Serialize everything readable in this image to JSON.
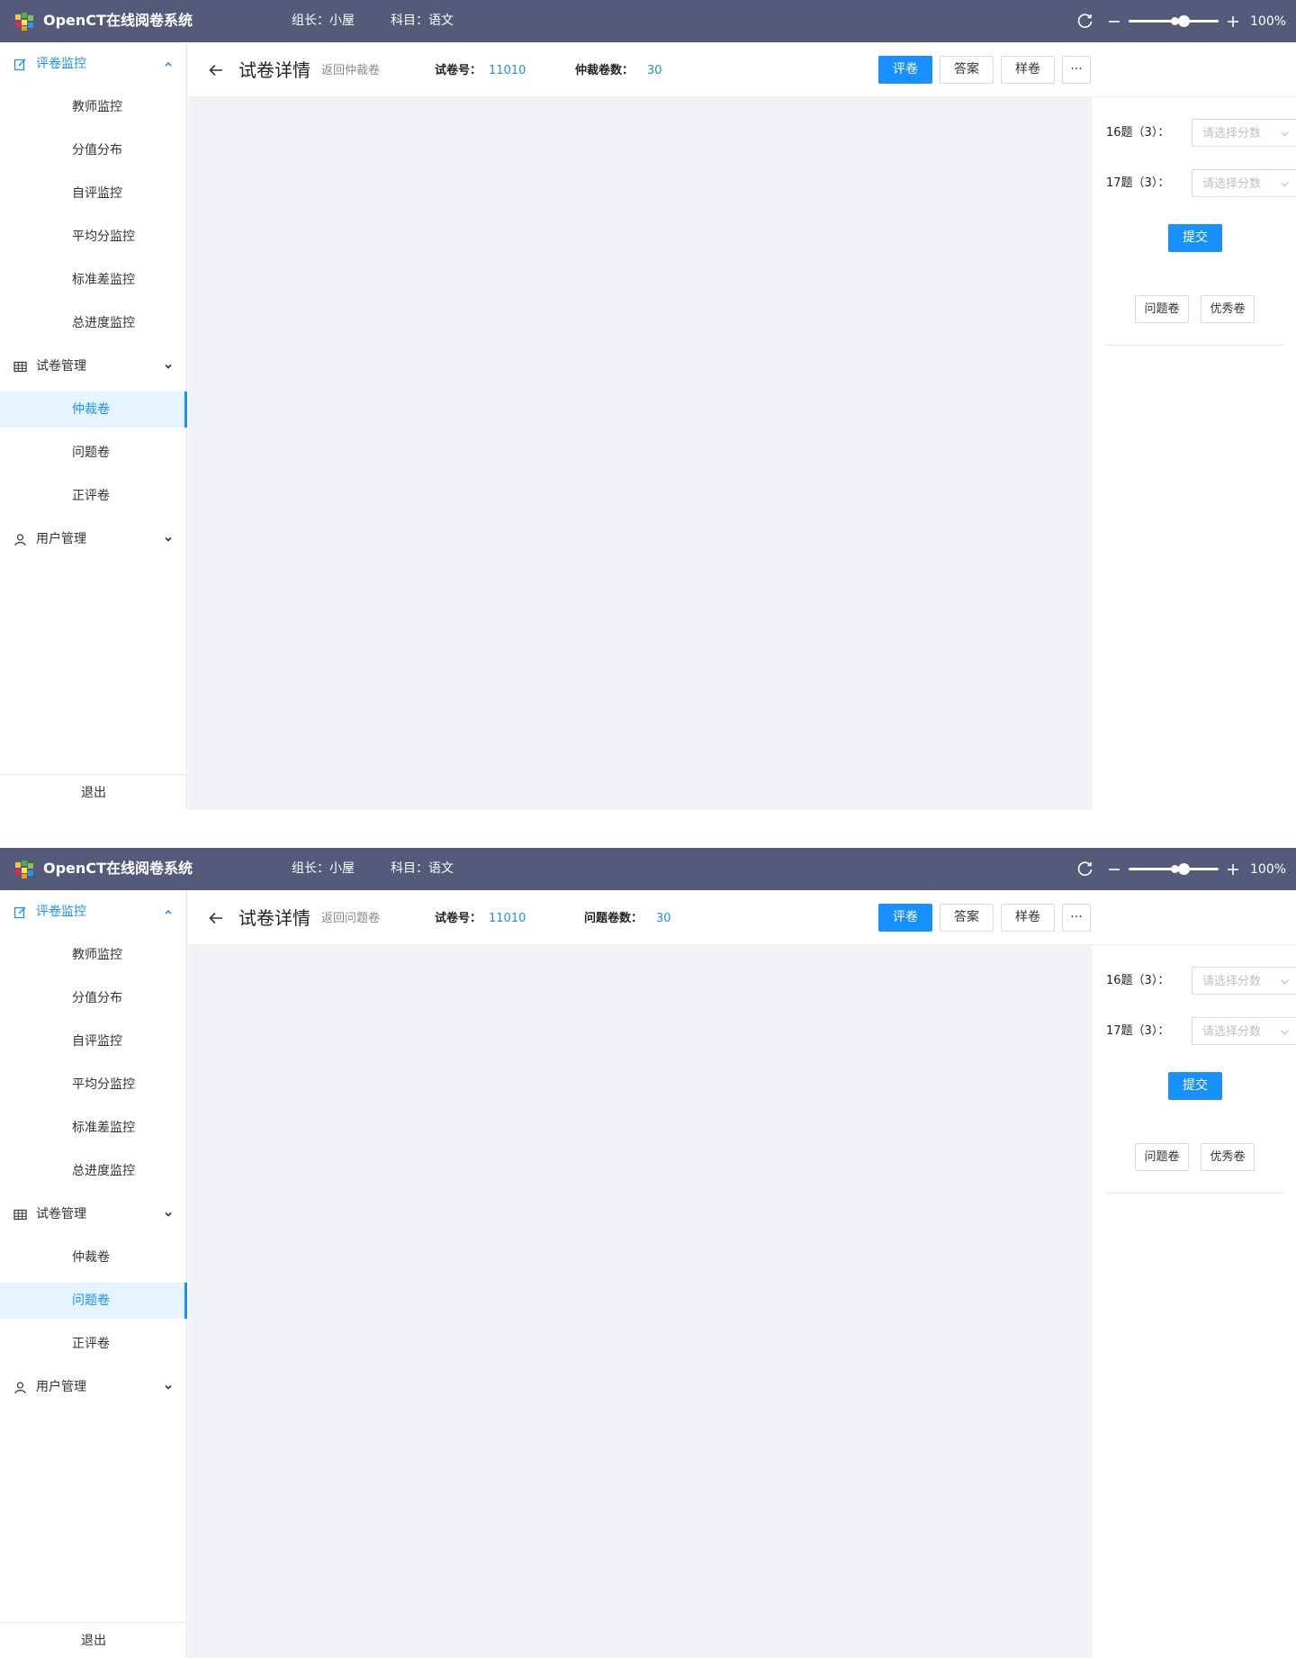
{
  "screens": [
    {
      "topbar": {
        "app_title": "OpenCT在线阅卷系统",
        "leader": "组长：小屋",
        "subject": "科目：语文",
        "zoom_value": "100%"
      },
      "sidebar": {
        "groups": [
          {
            "label": "评卷监控",
            "icon": "edit-icon",
            "expanded": true,
            "items": [
              {
                "label": "教师监控"
              },
              {
                "label": "分值分布"
              },
              {
                "label": "自评监控"
              },
              {
                "label": "平均分监控"
              },
              {
                "label": "标准差监控"
              },
              {
                "label": "总进度监控"
              }
            ]
          },
          {
            "label": "试卷管理",
            "icon": "table-icon",
            "expanded": false,
            "items": [
              {
                "label": "仲裁卷",
                "selected": true
              },
              {
                "label": "问题卷"
              },
              {
                "label": "正评卷"
              }
            ]
          },
          {
            "label": "用户管理",
            "icon": "user-icon",
            "expanded": false,
            "items": []
          }
        ],
        "logout": "退出"
      },
      "header": {
        "title": "试卷详情",
        "back_link": "返回仲裁卷",
        "paper_no_label": "试卷号：",
        "paper_no": "11010",
        "count_label": "仲裁卷数：",
        "count": "30",
        "buttons": {
          "grade": "评卷",
          "answer": "答案",
          "sample": "样卷",
          "more": "···"
        }
      },
      "panel": {
        "questions": [
          {
            "label": "16题（3）：",
            "placeholder": "请选择分数"
          },
          {
            "label": "17题（3）：",
            "placeholder": "请选择分数"
          }
        ],
        "submit": "提交",
        "problem_button": "问题卷",
        "excellent_button": "优秀卷"
      }
    },
    {
      "topbar": {
        "app_title": "OpenCT在线阅卷系统",
        "leader": "组长：小屋",
        "subject": "科目：语文",
        "zoom_value": "100%"
      },
      "sidebar": {
        "groups": [
          {
            "label": "评卷监控",
            "icon": "edit-icon",
            "expanded": true,
            "items": [
              {
                "label": "教师监控"
              },
              {
                "label": "分值分布"
              },
              {
                "label": "自评监控"
              },
              {
                "label": "平均分监控"
              },
              {
                "label": "标准差监控"
              },
              {
                "label": "总进度监控"
              }
            ]
          },
          {
            "label": "试卷管理",
            "icon": "table-icon",
            "expanded": false,
            "items": [
              {
                "label": "仲裁卷"
              },
              {
                "label": "问题卷",
                "selected": true
              },
              {
                "label": "正评卷"
              }
            ]
          },
          {
            "label": "用户管理",
            "icon": "user-icon",
            "expanded": false,
            "items": []
          }
        ],
        "logout": "退出"
      },
      "header": {
        "title": "试卷详情",
        "back_link": "返回问题卷",
        "paper_no_label": "试卷号：",
        "paper_no": "11010",
        "count_label": "问题卷数：",
        "count": "30",
        "buttons": {
          "grade": "评卷",
          "answer": "答案",
          "sample": "样卷",
          "more": "···"
        }
      },
      "panel": {
        "questions": [
          {
            "label": "16题（3）：",
            "placeholder": "请选择分数"
          },
          {
            "label": "17题（3）：",
            "placeholder": "请选择分数"
          }
        ],
        "submit": "提交",
        "problem_button": "问题卷",
        "excellent_button": "优秀卷"
      }
    }
  ],
  "colors": {
    "topbar": "#545b7a",
    "accent": "#1890ff",
    "selected_bg": "#e6f4ff",
    "content_bg": "#f0f2f5"
  }
}
